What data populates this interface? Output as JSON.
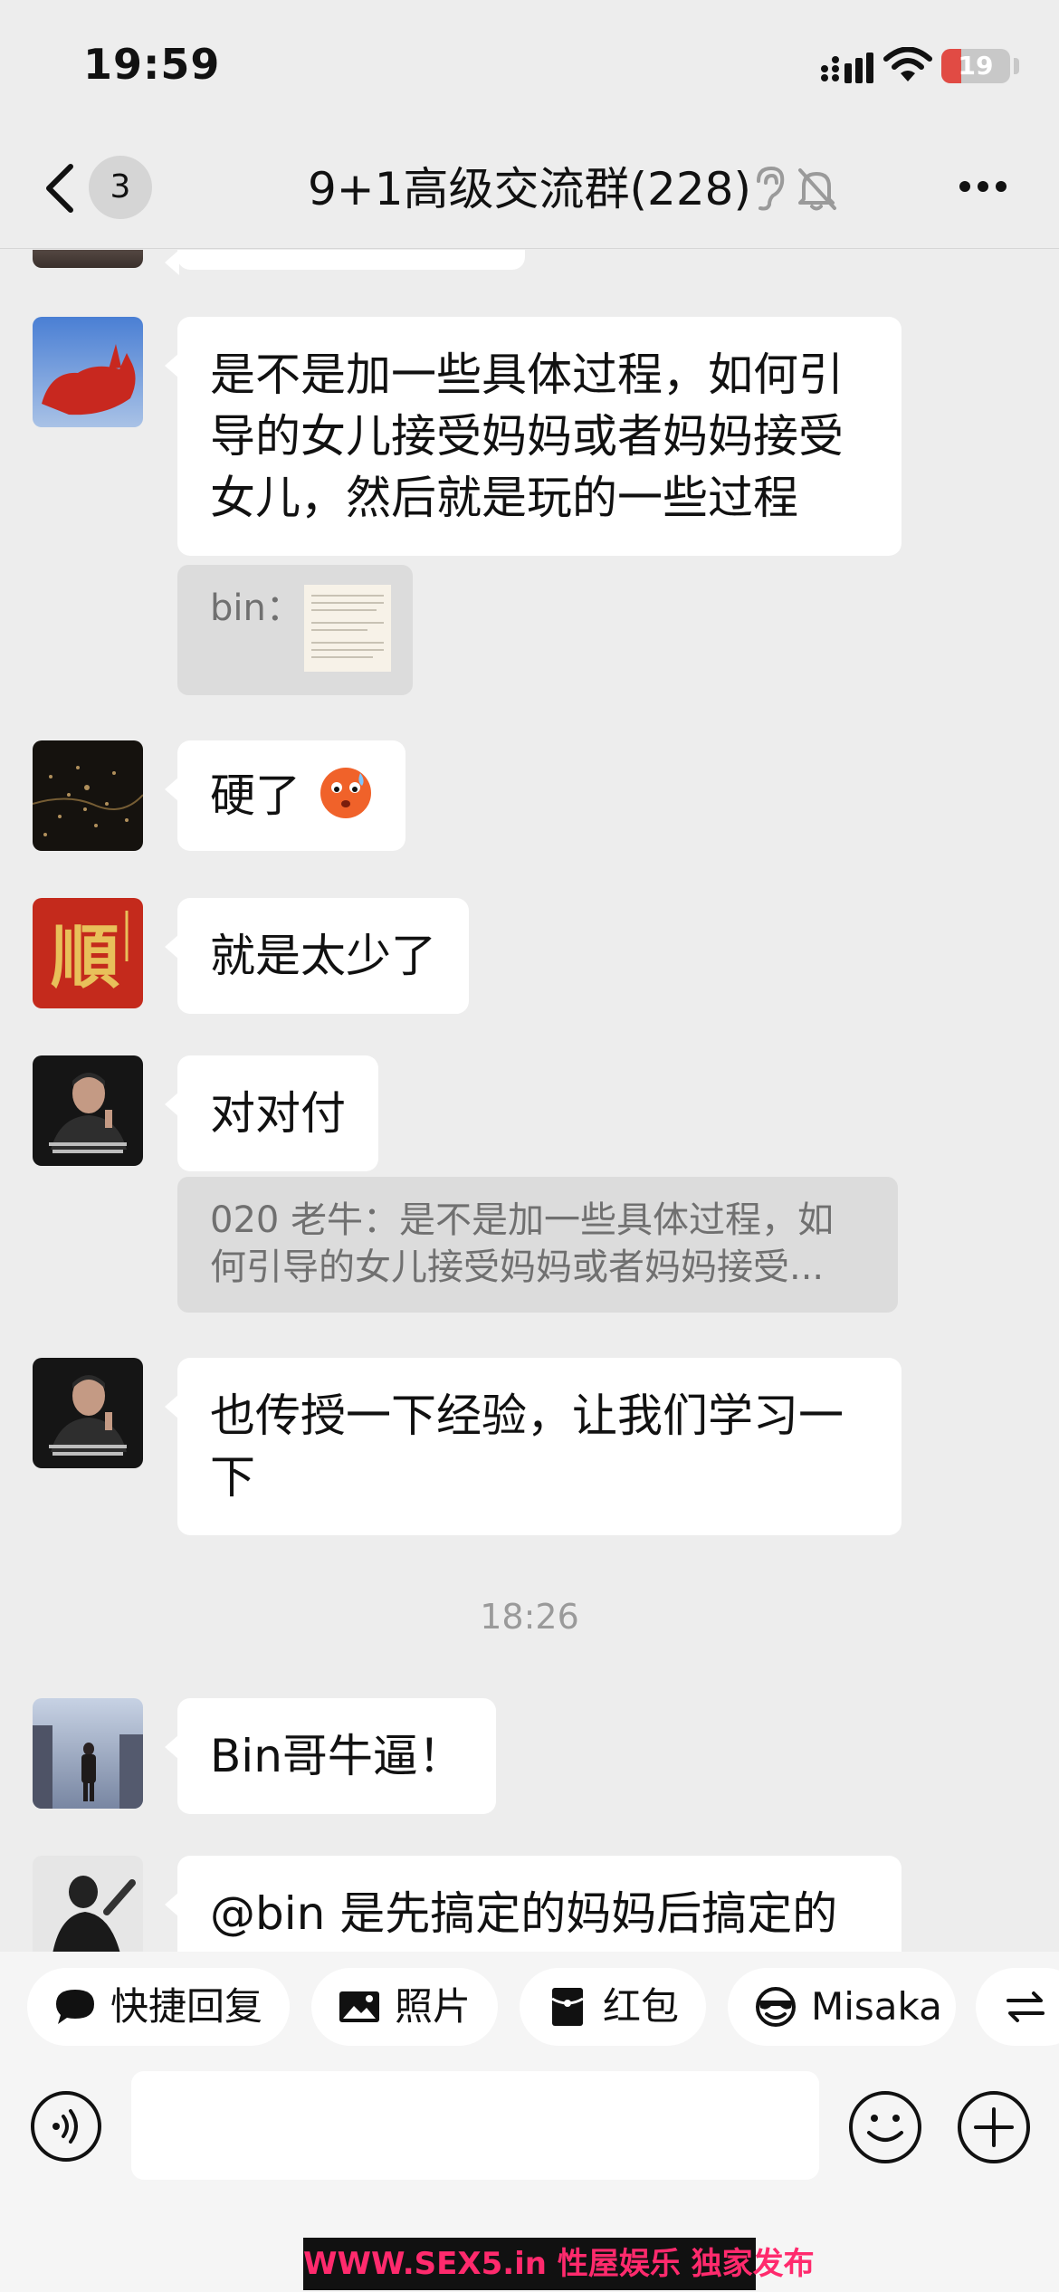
{
  "status_bar": {
    "time": "19:59",
    "battery_level": "19",
    "battery_fraction": 0.19
  },
  "header": {
    "unread_count": "3",
    "title": "9+1高级交流群(228)"
  },
  "messages": [
    {
      "text": "是不是加一些具体过程，如何引导的女儿接受妈妈或者妈妈接受女儿，然后就是玩的一些过程"
    },
    {
      "quote": "bin："
    },
    {
      "text": "硬了"
    },
    {
      "text": "就是太少了"
    },
    {
      "text": "对对付"
    },
    {
      "quote": "020 老牛：是不是加一些具体过程，如何引导的女儿接受妈妈或者妈妈接受..."
    },
    {
      "text": "也传授一下经验，让我们学习一下"
    },
    {
      "time": "18:26"
    },
    {
      "text": "Bin哥牛逼！"
    },
    {
      "text": "@bin 是先搞定的妈妈后搞定的"
    }
  ],
  "quick_actions": [
    {
      "label": "快捷回复",
      "icon": "chat-bubble-icon"
    },
    {
      "label": "照片",
      "icon": "image-icon"
    },
    {
      "label": "红包",
      "icon": "red-packet-icon"
    },
    {
      "label": "Misaka",
      "icon": "sunglasses-face-icon"
    }
  ],
  "watermark": "WWW.SEX5.in 性屋娱乐 独家发布",
  "colors": {
    "background": "#ededed",
    "bubble": "#ffffff",
    "quote": "#dcdcdc",
    "battery_low": "#e14b44"
  }
}
